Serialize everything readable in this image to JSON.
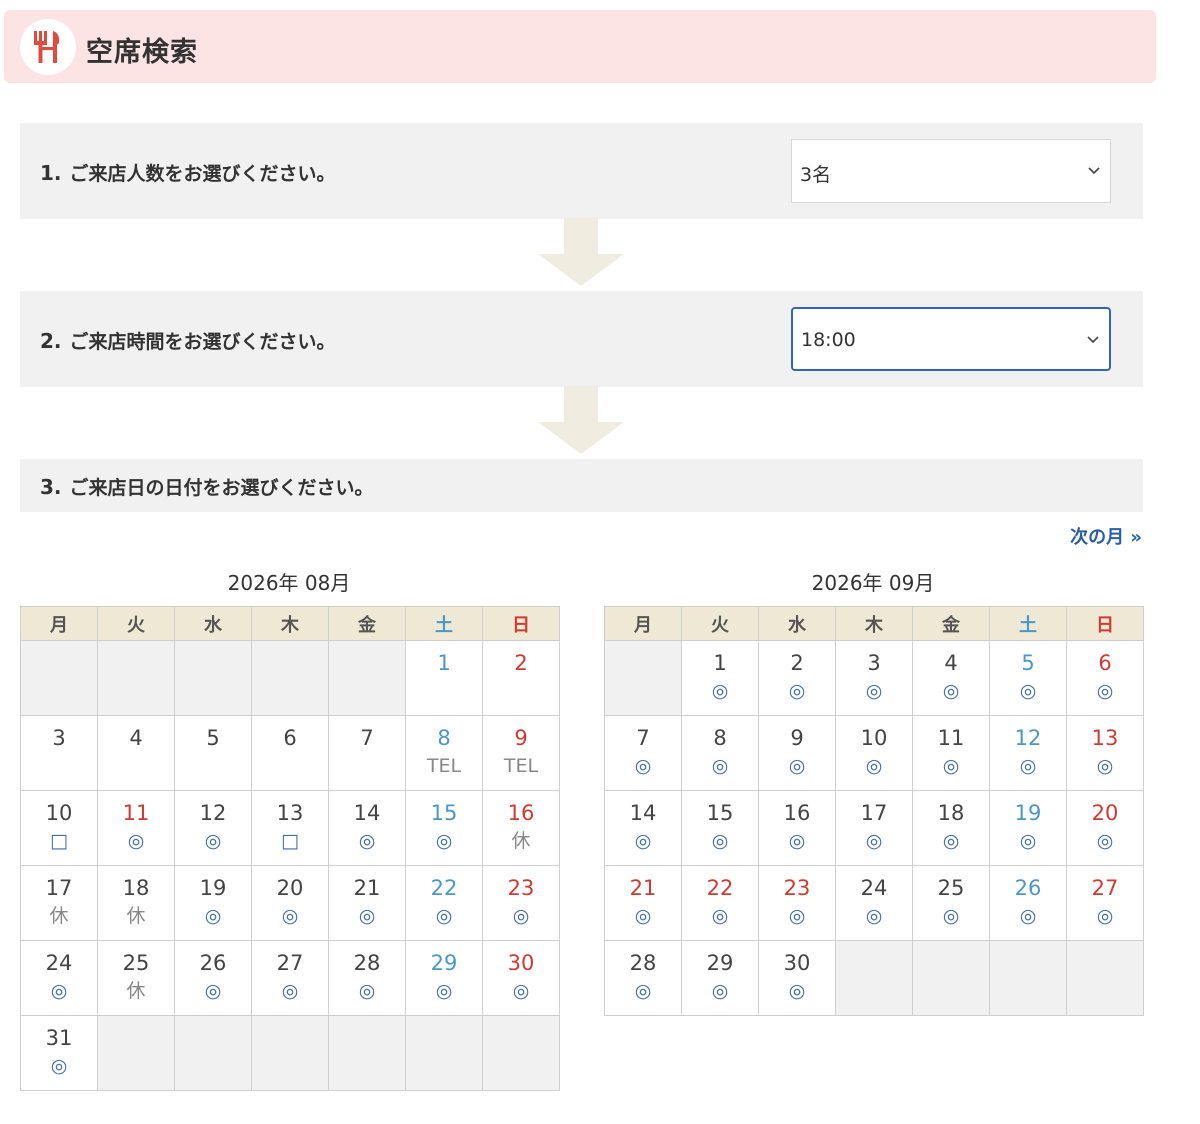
{
  "header": {
    "title": "空席検索"
  },
  "steps": [
    {
      "num": "1.",
      "label": "ご来店人数をお選びください。",
      "select_value": "3名"
    },
    {
      "num": "2.",
      "label": "ご来店時間をお選びください。",
      "select_value": "18:00"
    },
    {
      "num": "3.",
      "label": "ご来店日の日付をお選びください。"
    }
  ],
  "next_month": "次の月 »",
  "weekdays": [
    "月",
    "火",
    "水",
    "木",
    "金",
    "土",
    "日"
  ],
  "calendars": [
    {
      "title": "2026年 08月",
      "weeks": [
        [
          null,
          null,
          null,
          null,
          null,
          {
            "d": "1",
            "s": ""
          },
          {
            "d": "2",
            "s": ""
          }
        ],
        [
          {
            "d": "3",
            "s": ""
          },
          {
            "d": "4",
            "s": ""
          },
          {
            "d": "5",
            "s": ""
          },
          {
            "d": "6",
            "s": ""
          },
          {
            "d": "7",
            "s": ""
          },
          {
            "d": "8",
            "s": "TEL"
          },
          {
            "d": "9",
            "s": "TEL"
          }
        ],
        [
          {
            "d": "10",
            "s": "□"
          },
          {
            "d": "11",
            "s": "◎",
            "red": true
          },
          {
            "d": "12",
            "s": "◎"
          },
          {
            "d": "13",
            "s": "□"
          },
          {
            "d": "14",
            "s": "◎"
          },
          {
            "d": "15",
            "s": "◎"
          },
          {
            "d": "16",
            "s": "休"
          }
        ],
        [
          {
            "d": "17",
            "s": "休"
          },
          {
            "d": "18",
            "s": "休"
          },
          {
            "d": "19",
            "s": "◎"
          },
          {
            "d": "20",
            "s": "◎"
          },
          {
            "d": "21",
            "s": "◎"
          },
          {
            "d": "22",
            "s": "◎"
          },
          {
            "d": "23",
            "s": "◎"
          }
        ],
        [
          {
            "d": "24",
            "s": "◎"
          },
          {
            "d": "25",
            "s": "休"
          },
          {
            "d": "26",
            "s": "◎"
          },
          {
            "d": "27",
            "s": "◎"
          },
          {
            "d": "28",
            "s": "◎"
          },
          {
            "d": "29",
            "s": "◎"
          },
          {
            "d": "30",
            "s": "◎"
          }
        ],
        [
          {
            "d": "31",
            "s": "◎"
          },
          null,
          null,
          null,
          null,
          null,
          null
        ]
      ]
    },
    {
      "title": "2026年 09月",
      "weeks": [
        [
          null,
          {
            "d": "1",
            "s": "◎"
          },
          {
            "d": "2",
            "s": "◎"
          },
          {
            "d": "3",
            "s": "◎"
          },
          {
            "d": "4",
            "s": "◎"
          },
          {
            "d": "5",
            "s": "◎"
          },
          {
            "d": "6",
            "s": "◎"
          }
        ],
        [
          {
            "d": "7",
            "s": "◎"
          },
          {
            "d": "8",
            "s": "◎"
          },
          {
            "d": "9",
            "s": "◎"
          },
          {
            "d": "10",
            "s": "◎"
          },
          {
            "d": "11",
            "s": "◎"
          },
          {
            "d": "12",
            "s": "◎"
          },
          {
            "d": "13",
            "s": "◎"
          }
        ],
        [
          {
            "d": "14",
            "s": "◎"
          },
          {
            "d": "15",
            "s": "◎"
          },
          {
            "d": "16",
            "s": "◎"
          },
          {
            "d": "17",
            "s": "◎"
          },
          {
            "d": "18",
            "s": "◎"
          },
          {
            "d": "19",
            "s": "◎"
          },
          {
            "d": "20",
            "s": "◎"
          }
        ],
        [
          {
            "d": "21",
            "s": "◎",
            "red": true
          },
          {
            "d": "22",
            "s": "◎",
            "red": true
          },
          {
            "d": "23",
            "s": "◎",
            "red": true
          },
          {
            "d": "24",
            "s": "◎"
          },
          {
            "d": "25",
            "s": "◎"
          },
          {
            "d": "26",
            "s": "◎"
          },
          {
            "d": "27",
            "s": "◎"
          }
        ],
        [
          {
            "d": "28",
            "s": "◎"
          },
          {
            "d": "29",
            "s": "◎"
          },
          {
            "d": "30",
            "s": "◎"
          },
          null,
          null,
          null,
          null
        ]
      ]
    }
  ],
  "colors": {
    "header_bg": "#fce4e4",
    "accent_red": "#d23a2e",
    "saturday_blue": "#4a98c9",
    "link_blue": "#2a5ba8",
    "focus_blue": "#3164c7"
  }
}
